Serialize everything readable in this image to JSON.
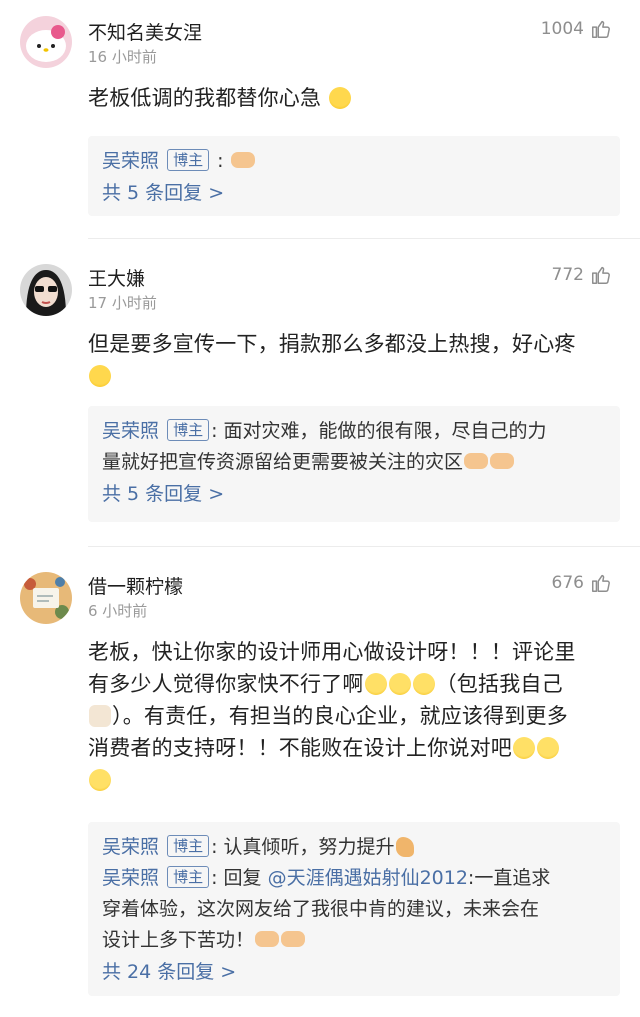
{
  "comments": [
    {
      "username": "不知名美女涅",
      "time": "16 小时前",
      "likes": "1004",
      "text": "老板低调的我都替你心急",
      "replies": [
        {
          "name": "吴荣照",
          "tag": "博主",
          "text": ":"
        }
      ],
      "more": "共 5 条回复 >"
    },
    {
      "username": "王大嫌",
      "time": "17 小时前",
      "likes": "772",
      "text": "但是要多宣传一下，捐款那么多都没上热搜，好心疼",
      "replies": [
        {
          "name": "吴荣照",
          "tag": "博主",
          "text1": ": 面对灾难，能做的很有限，尽自己的力",
          "text2": "量就好把宣传资源留给更需要被关注的灾区"
        }
      ],
      "more": "共 5 条回复 >"
    },
    {
      "username": "借一颗柠檬",
      "time": "6 小时前",
      "likes": "676",
      "text_line1": "老板，快让你家的设计师用心做设计呀！！！评论里",
      "text_line2": "有多少人觉得你家快不行了啊",
      "text_line2b": "（包括我自己",
      "text_line3": "）。有责任，有担当的良心企业，就应该得到更多",
      "text_line4": "消费者的支持呀！！不能败在设计上你说对吧",
      "replies": [
        {
          "name": "吴荣照",
          "tag": "博主",
          "text": ": 认真倾听，努力提升"
        },
        {
          "name": "吴荣照",
          "tag": "博主",
          "prefix": ": 回复 ",
          "mention": "@天涯偶遇姑射仙2012",
          "text1": ":一直追求",
          "text2": "穿着体验，这次网友给了我很中肯的建议，未来会在",
          "text3": "设计上多下苦功！"
        }
      ],
      "more": "共 24 条回复 >"
    }
  ],
  "icons": {
    "like": "thumbs-up-outline-icon"
  },
  "colors": {
    "link_blue": "#4a6fa5",
    "reply_bg": "#f6f6f6",
    "muted": "#9a9a9a"
  }
}
